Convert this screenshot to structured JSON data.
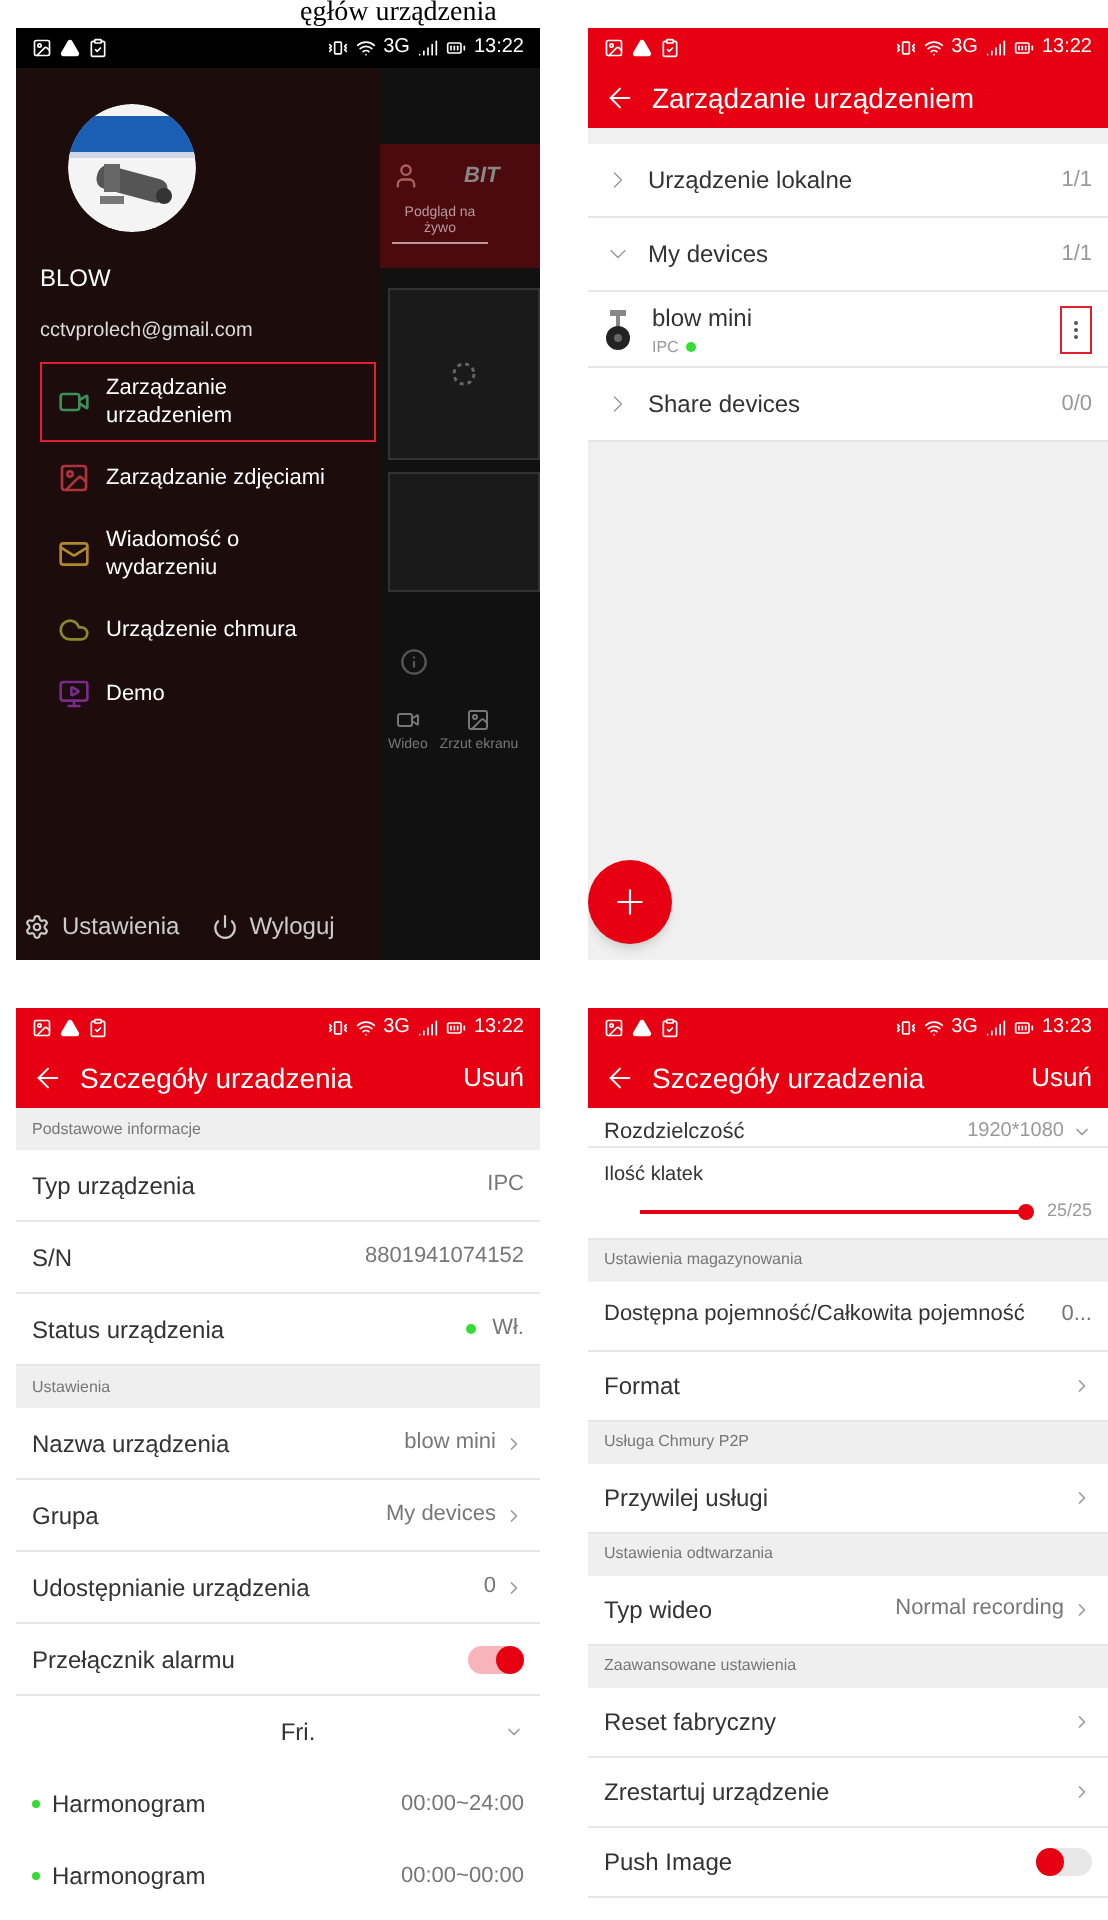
{
  "page_heading": "ęgłów urządzenia",
  "drawer_screen": {
    "status_bar": {
      "network": "3G",
      "time": "13:22"
    },
    "user": {
      "name": "BLOW",
      "email": "cctvprolech@gmail.com"
    },
    "menu": [
      {
        "kind": "device",
        "label": "Zarządzanie urzadzeniem",
        "selected": true,
        "color": "#3c8f5a"
      },
      {
        "label": "Zarządzanie zdjęciami",
        "selected": false,
        "color": "#b0323a"
      },
      {
        "kind": "message",
        "label": "Wiadomość o wydarzeniu",
        "selected": false,
        "color": "#b08a2a"
      },
      {
        "kind": "cloud",
        "label": "Urządzenie chmura",
        "selected": false,
        "color": "#8a8a2a"
      },
      {
        "kind": "demo",
        "label": "Demo",
        "selected": false,
        "color": "#7a2a8a"
      }
    ],
    "footer": [
      {
        "kind": "settings",
        "label": "Ustawienia"
      },
      {
        "kind": "logout",
        "label": "Wyloguj"
      }
    ],
    "background_app": {
      "brand": "BIT",
      "tab": "Podgląd na żywo",
      "actions": [
        {
          "kind": "video",
          "label": "Wideo"
        },
        {
          "kind": "screenshot",
          "label": "Zrzut ekranu"
        }
      ]
    }
  },
  "device_list_screen": {
    "status_bar": {
      "network": "3G",
      "time": "13:22"
    },
    "title": "Zarządzanie urządzeniem",
    "groups": [
      {
        "label": "Urządzenie lokalne",
        "count": "1/1",
        "expanded": false
      },
      {
        "label": "My devices",
        "count": "1/1",
        "expanded": true,
        "devices": [
          {
            "name": "blow mini",
            "type": "IPC",
            "online": true,
            "highlighted": true
          }
        ]
      },
      {
        "label": "Share devices",
        "count": "0/0",
        "expanded": false
      }
    ]
  },
  "details_screen": {
    "status_bar": {
      "network": "3G",
      "time": "13:22"
    },
    "title": "Szczegóły urzadzenia",
    "action": "Usuń",
    "sections": [
      {
        "header": "Podstawowe informacje",
        "rows": [
          {
            "kind": "value",
            "label": "Typ urządzenia",
            "value": "IPC"
          },
          {
            "kind": "value",
            "label": "S/N",
            "value": "8801941074152"
          },
          {
            "kind": "status",
            "label": "Status urządzenia",
            "value": "Wł.",
            "online": true
          }
        ]
      },
      {
        "header": "Ustawienia",
        "rows": [
          {
            "kind": "link",
            "label": "Nazwa urządzenia",
            "value": "blow mini"
          },
          {
            "kind": "link",
            "label": "Grupa",
            "value": "My devices"
          },
          {
            "kind": "link",
            "label": "Udostępnianie urządzenia",
            "value": "0"
          },
          {
            "kind": "toggle",
            "label": "Przełącznik alarmu",
            "on": true
          }
        ]
      }
    ],
    "schedule": {
      "day": "Fri.",
      "items": [
        {
          "label": "Harmonogram",
          "time": "00:00~24:00"
        },
        {
          "label": "Harmonogram",
          "time": "00:00~00:00"
        }
      ]
    }
  },
  "details_scrolled_screen": {
    "status_bar": {
      "network": "3G",
      "time": "13:23"
    },
    "title": "Szczegóły urzadzenia",
    "action": "Usuń",
    "sections": [
      {
        "rows": [
          {
            "kind": "select",
            "label": "Rozdzielczość",
            "value": "1920*1080"
          },
          {
            "kind": "slider",
            "label": "Ilość klatek",
            "level": 1,
            "reading": "25/25"
          }
        ]
      },
      {
        "header": "Ustawienia magazynowania",
        "rows": [
          {
            "kind": "value",
            "label": "Dostępna pojemność/Całkowita pojemność",
            "value": "0..."
          },
          {
            "kind": "link",
            "label": "Format"
          }
        ]
      },
      {
        "header": "Usługa Chmury P2P",
        "rows": [
          {
            "kind": "link",
            "label": "Przywilej usługi"
          }
        ]
      },
      {
        "header": "Ustawienia odtwarzania",
        "rows": [
          {
            "kind": "link",
            "label": "Typ wideo",
            "value": "Normal recording"
          }
        ]
      },
      {
        "header": "Zaawansowane ustawienia",
        "rows": [
          {
            "kind": "link",
            "label": "Reset fabryczny"
          },
          {
            "kind": "link",
            "label": "Zrestartuj urządzenie"
          },
          {
            "kind": "toggle",
            "label": "Push Image",
            "on": false
          }
        ]
      }
    ]
  }
}
